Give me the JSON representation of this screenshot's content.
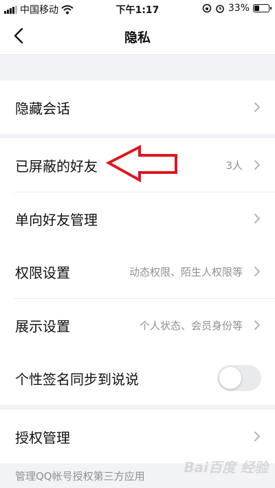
{
  "status_bar": {
    "carrier": "中国移动",
    "time": "下午1:17",
    "battery_text": "33%",
    "battery_level": 0.33,
    "icons": [
      "signal-icon",
      "wifi-icon",
      "lock-rotation-icon",
      "alarm-icon",
      "battery-icon"
    ]
  },
  "nav": {
    "title": "隐私",
    "back_icon": "chevron-left-icon"
  },
  "groups": [
    {
      "rows": [
        {
          "label": "隐藏会话",
          "value": ""
        }
      ]
    },
    {
      "rows": [
        {
          "label": "已屏蔽的好友",
          "value": "3人"
        },
        {
          "label": "单向好友管理",
          "value": ""
        }
      ]
    },
    {
      "rows": [
        {
          "label": "权限设置",
          "value": "动态权限、陌生人权限等"
        },
        {
          "label": "展示设置",
          "value": "个人状态、会员身份等"
        }
      ]
    },
    {
      "rows": [
        {
          "label": "个性签名同步到说说",
          "toggle_on": false
        }
      ]
    },
    {
      "rows": [
        {
          "label": "授权管理",
          "value": ""
        }
      ]
    }
  ],
  "footer_note": "管理QQ帐号授权第三方应用",
  "watermark": "Bai百度 经验",
  "colors": {
    "page_bg": "#f2f3f6",
    "card_bg": "#ffffff",
    "secondary_text": "#8f9096",
    "annotation_arrow": "#e0141e"
  }
}
